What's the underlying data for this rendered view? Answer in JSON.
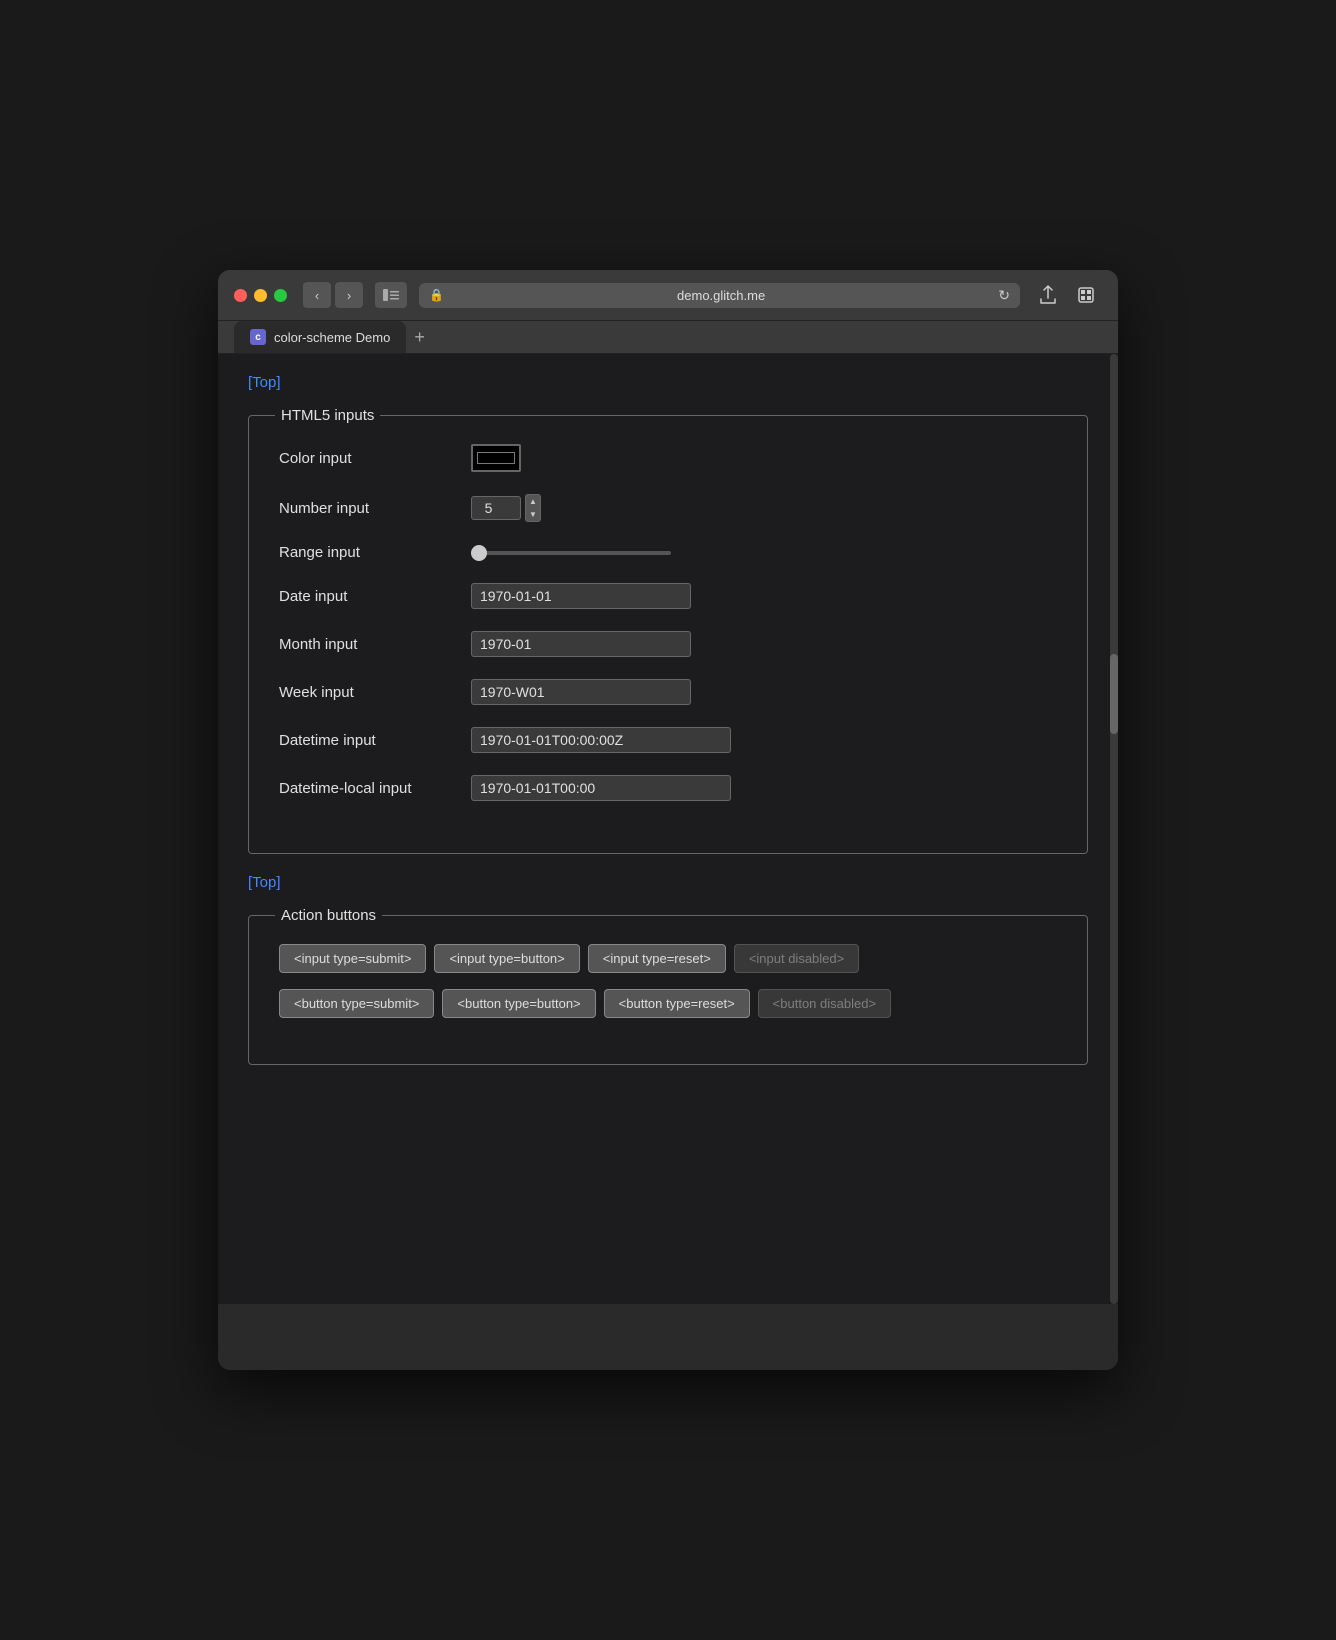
{
  "browser": {
    "url": "demo.glitch.me",
    "tab_title": "color-scheme Demo",
    "tab_favicon_letter": "c",
    "back_icon": "‹",
    "forward_icon": "›",
    "reload_icon": "↻",
    "share_icon": "↑",
    "new_tab_icon": "+"
  },
  "page": {
    "top_link": "[Top]",
    "html5_section": {
      "legend": "HTML5 inputs",
      "fields": [
        {
          "label": "Color input",
          "type": "color",
          "value": "#000000"
        },
        {
          "label": "Number input",
          "type": "number",
          "value": "5"
        },
        {
          "label": "Range input",
          "type": "range",
          "value": "0"
        },
        {
          "label": "Date input",
          "type": "date",
          "value": "1970-01-01"
        },
        {
          "label": "Month input",
          "type": "month",
          "value": "1970-01"
        },
        {
          "label": "Week input",
          "type": "week",
          "value": "1970-W01"
        },
        {
          "label": "Datetime input",
          "type": "datetime",
          "value": "1970-01-01T00:00:00Z"
        },
        {
          "label": "Datetime-local input",
          "type": "datetime-local",
          "value": "1970-01-01T00:00"
        }
      ]
    },
    "action_buttons_section": {
      "legend": "Action buttons",
      "input_buttons": [
        {
          "label": "<input type=submit>",
          "type": "submit",
          "disabled": false
        },
        {
          "label": "<input type=button>",
          "type": "button",
          "disabled": false
        },
        {
          "label": "<input type=reset>",
          "type": "reset",
          "disabled": false
        },
        {
          "label": "<input disabled>",
          "type": "button",
          "disabled": true
        }
      ],
      "button_buttons": [
        {
          "label": "<button type=submit>",
          "type": "submit",
          "disabled": false
        },
        {
          "label": "<button type=button>",
          "type": "button",
          "disabled": false
        },
        {
          "label": "<button type=reset>",
          "type": "reset",
          "disabled": false
        },
        {
          "label": "<button disabled>",
          "type": "button",
          "disabled": true
        }
      ]
    },
    "bottom_top_link": "[Top]"
  }
}
